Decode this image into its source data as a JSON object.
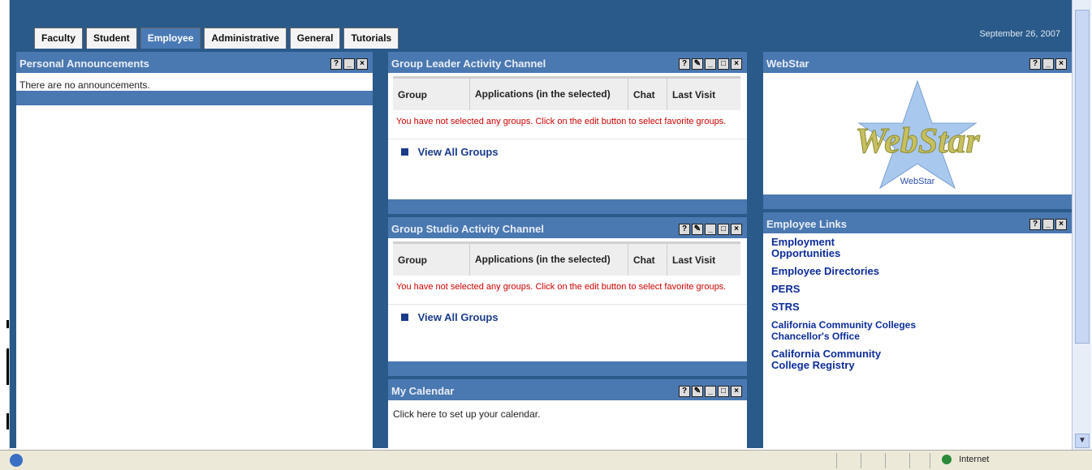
{
  "header": {
    "date": "September 26, 2007"
  },
  "tabs": [
    {
      "label": "Faculty"
    },
    {
      "label": "Student"
    },
    {
      "label": "Employee"
    },
    {
      "label": "Administrative"
    },
    {
      "label": "General"
    },
    {
      "label": "Tutorials"
    }
  ],
  "personal": {
    "title": "Personal Announcements",
    "body": "There are no announcements."
  },
  "group_leader": {
    "title": "Group Leader Activity Channel",
    "col_group": "Group",
    "col_apps": "Applications (in the selected)",
    "col_chat": "Chat",
    "col_last": "Last Visit",
    "message": "You have not selected any groups. Click on the edit button to select favorite groups.",
    "view_all": "View All Groups"
  },
  "group_studio": {
    "title": "Group Studio Activity Channel",
    "col_group": "Group",
    "col_apps": "Applications (in the selected)",
    "col_chat": "Chat",
    "col_last": "Last Visit",
    "message": "You have not selected any groups. Click on the edit button to select favorite groups.",
    "view_all": "View All Groups"
  },
  "calendar": {
    "title": "My Calendar",
    "body": "Click here to set up your calendar."
  },
  "webstar": {
    "title": "WebStar",
    "logo_text": "WebStar",
    "caption": "WebStar"
  },
  "links": {
    "title": "Employee Links",
    "items": [
      {
        "label": "Employment Opportunities"
      },
      {
        "label": "Employee Directories"
      },
      {
        "label": "PERS"
      },
      {
        "label": "STRS"
      },
      {
        "label": "California Community Colleges Chancellor's Office"
      },
      {
        "label": "California Community College Registry"
      }
    ]
  },
  "status": {
    "zone": "Internet"
  }
}
